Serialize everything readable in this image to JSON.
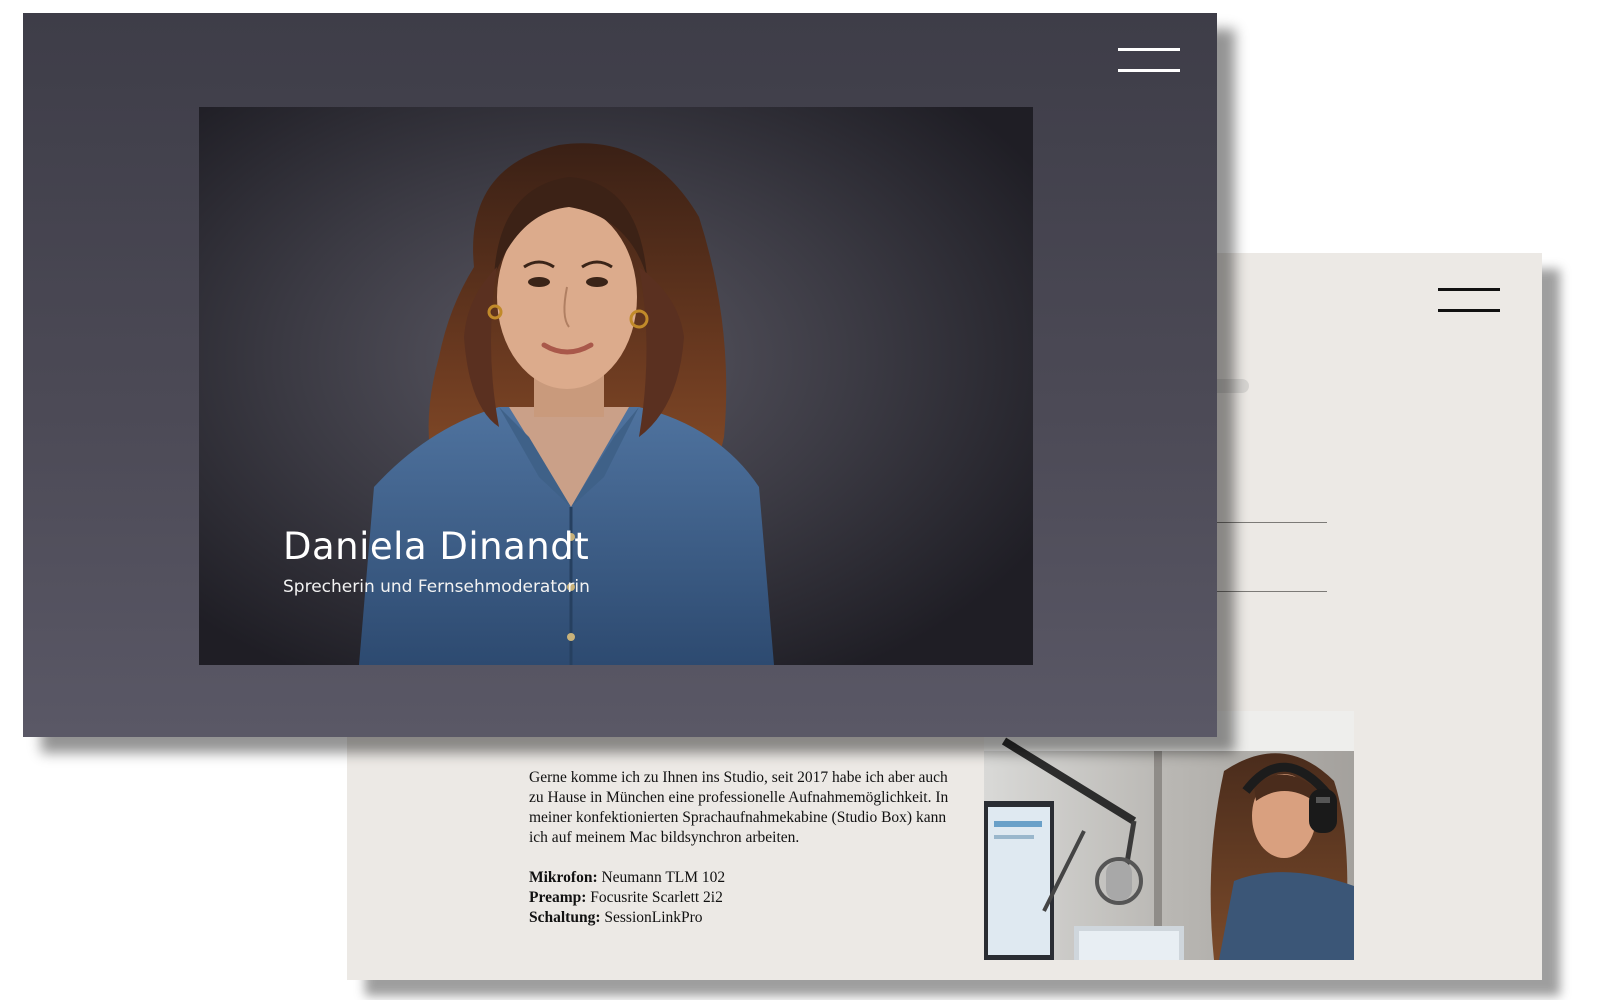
{
  "colors": {
    "hero_background": "#46444f",
    "page_background": "#ece9e5",
    "text_dark": "#111111",
    "text_light": "#ffffff"
  },
  "hero": {
    "menu_icon": "hamburger-menu-icon",
    "name": "Daniela Dinandt",
    "subtitle": "Sprecherin und Fernsehmoderatorin",
    "photo": "portrait-photo"
  },
  "studio": {
    "menu_icon": "hamburger-menu-icon",
    "intro": "Gerne komme ich zu Ihnen ins Studio, seit 2017 habe ich aber auch zu Hause in München eine professionelle Aufnahmemöglichkeit. In meiner konfektionierten Sprachaufnahmekabine (Studio Box) kann ich auf meinem Mac bildsynchron arbeiten.",
    "specs": [
      {
        "label": "Mikrofon:",
        "value": "Neumann TLM 102"
      },
      {
        "label": "Preamp:",
        "value": "Focusrite Scarlett 2i2"
      },
      {
        "label": "Schaltung:",
        "value": "SessionLinkPro"
      }
    ],
    "photo": "studio-recording-photo"
  }
}
